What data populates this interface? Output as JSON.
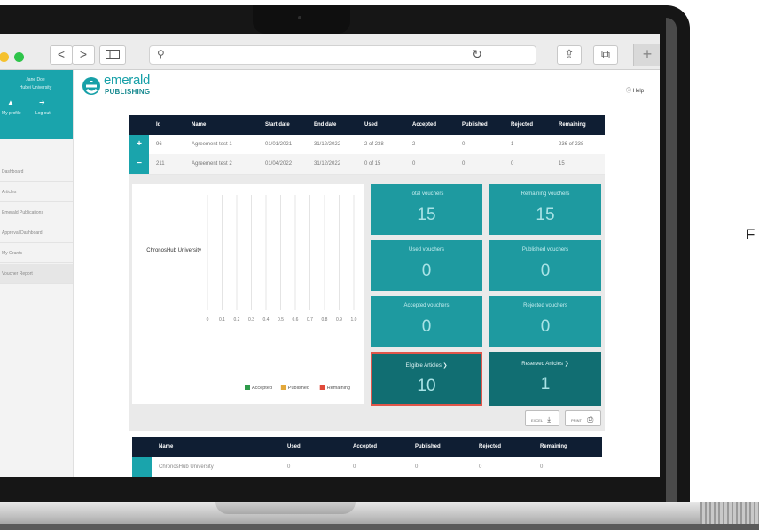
{
  "browser": {
    "traffic_colors": [
      "#f5c12e",
      "#2ec44a"
    ],
    "back": "<",
    "forward": ">",
    "search_glyph": "⚲",
    "reload_glyph": "↻",
    "share_glyph": "⇪",
    "tabs_glyph": "⧉",
    "newtab_glyph": "+"
  },
  "sidebar": {
    "user_name": "Jane Doe",
    "user_org": "Hubei University",
    "my_profile": "My profile",
    "log_out": "Log out",
    "items": [
      "Dashboard",
      "Articles",
      "Emerald Publications",
      "Approval Dashboard",
      "My Grants",
      "Voucher Report"
    ]
  },
  "brand": {
    "line1": "emerald",
    "line2": "PUBLISHING",
    "color": "#17a0a8"
  },
  "help": "Help",
  "agreements": {
    "headers": [
      "Id",
      "Name",
      "Start date",
      "End date",
      "Used",
      "Accepted",
      "Published",
      "Rejected",
      "Remaining"
    ],
    "rows": [
      {
        "toggle": "+",
        "id": "96",
        "name": "Agreement test 1",
        "start": "01/01/2021",
        "end": "31/12/2022",
        "used": "2 of 238",
        "accepted": "2",
        "published": "0",
        "rejected": "1",
        "remaining": "236 of 238"
      },
      {
        "toggle": "−",
        "id": "211",
        "name": "Agreement test 2",
        "start": "01/04/2022",
        "end": "31/12/2022",
        "used": "0 of 15",
        "accepted": "0",
        "published": "0",
        "rejected": "0",
        "remaining": "15"
      }
    ]
  },
  "chart_data": {
    "type": "bar",
    "orientation": "horizontal",
    "categories": [
      "ChronosHub University"
    ],
    "series": [
      {
        "name": "Accepted",
        "values": [
          0
        ],
        "color": "#2e9a4a"
      },
      {
        "name": "Published",
        "values": [
          0
        ],
        "color": "#e3a83a"
      },
      {
        "name": "Remaining",
        "values": [
          0
        ],
        "color": "#e04a3a"
      }
    ],
    "x_ticks": [
      "0",
      "0.1",
      "0.2",
      "0.3",
      "0.4",
      "0.5",
      "0.6",
      "0.7",
      "0.8",
      "0.9",
      "1.0"
    ],
    "xlim": [
      0,
      1
    ],
    "grid": true,
    "legend_position": "bottom-right"
  },
  "tiles": [
    {
      "label": "Total vouchers",
      "value": "15"
    },
    {
      "label": "Remaining vouchers",
      "value": "15"
    },
    {
      "label": "Used vouchers",
      "value": "0"
    },
    {
      "label": "Published vouchers",
      "value": "0"
    },
    {
      "label": "Accepted vouchers",
      "value": "0"
    },
    {
      "label": "Rejected vouchers",
      "value": "0"
    },
    {
      "label": "Eligible Articles ❯",
      "value": "10"
    },
    {
      "label": "Reserved Articles ❯",
      "value": "1"
    }
  ],
  "exports": {
    "excel": "EXCEL",
    "print": "PRINT",
    "download_glyph": "⤓",
    "print_glyph": "⎙"
  },
  "summary": {
    "headers": [
      "Name",
      "Used",
      "Accepted",
      "Published",
      "Rejected",
      "Remaining"
    ],
    "row": [
      "ChronosHub University",
      "0",
      "0",
      "0",
      "0",
      "0"
    ]
  },
  "side_text": "F"
}
